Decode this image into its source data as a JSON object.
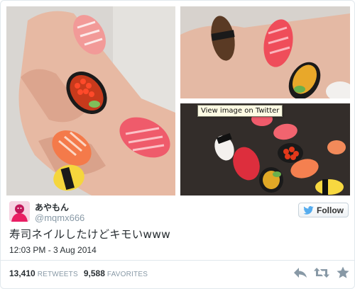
{
  "media": {
    "tooltip": "View image on Twitter"
  },
  "author": {
    "name": "あやもん",
    "handle": "@mqmx666"
  },
  "follow": {
    "label": "Follow"
  },
  "tweet": {
    "text": "寿司ネイルしたけどキモいwww",
    "timestamp": "12:03 PM - 3 Aug 2014"
  },
  "stats": {
    "retweets_count": "13,410",
    "retweets_label": "RETWEETS",
    "favorites_count": "9,588",
    "favorites_label": "FAVORITES"
  },
  "icons": {
    "follow": "twitter-bird-icon",
    "reply": "reply-icon",
    "retweet": "retweet-icon",
    "favorite": "star-icon"
  },
  "colors": {
    "twitter_blue": "#55acee",
    "muted_text": "#8899a6",
    "tuna": "#e8475d",
    "salmon": "#f47a4a",
    "egg": "#f7d84a",
    "ikura": "#e23a1c",
    "cucumber": "#6aa84f",
    "nori": "#1a1a1a"
  }
}
